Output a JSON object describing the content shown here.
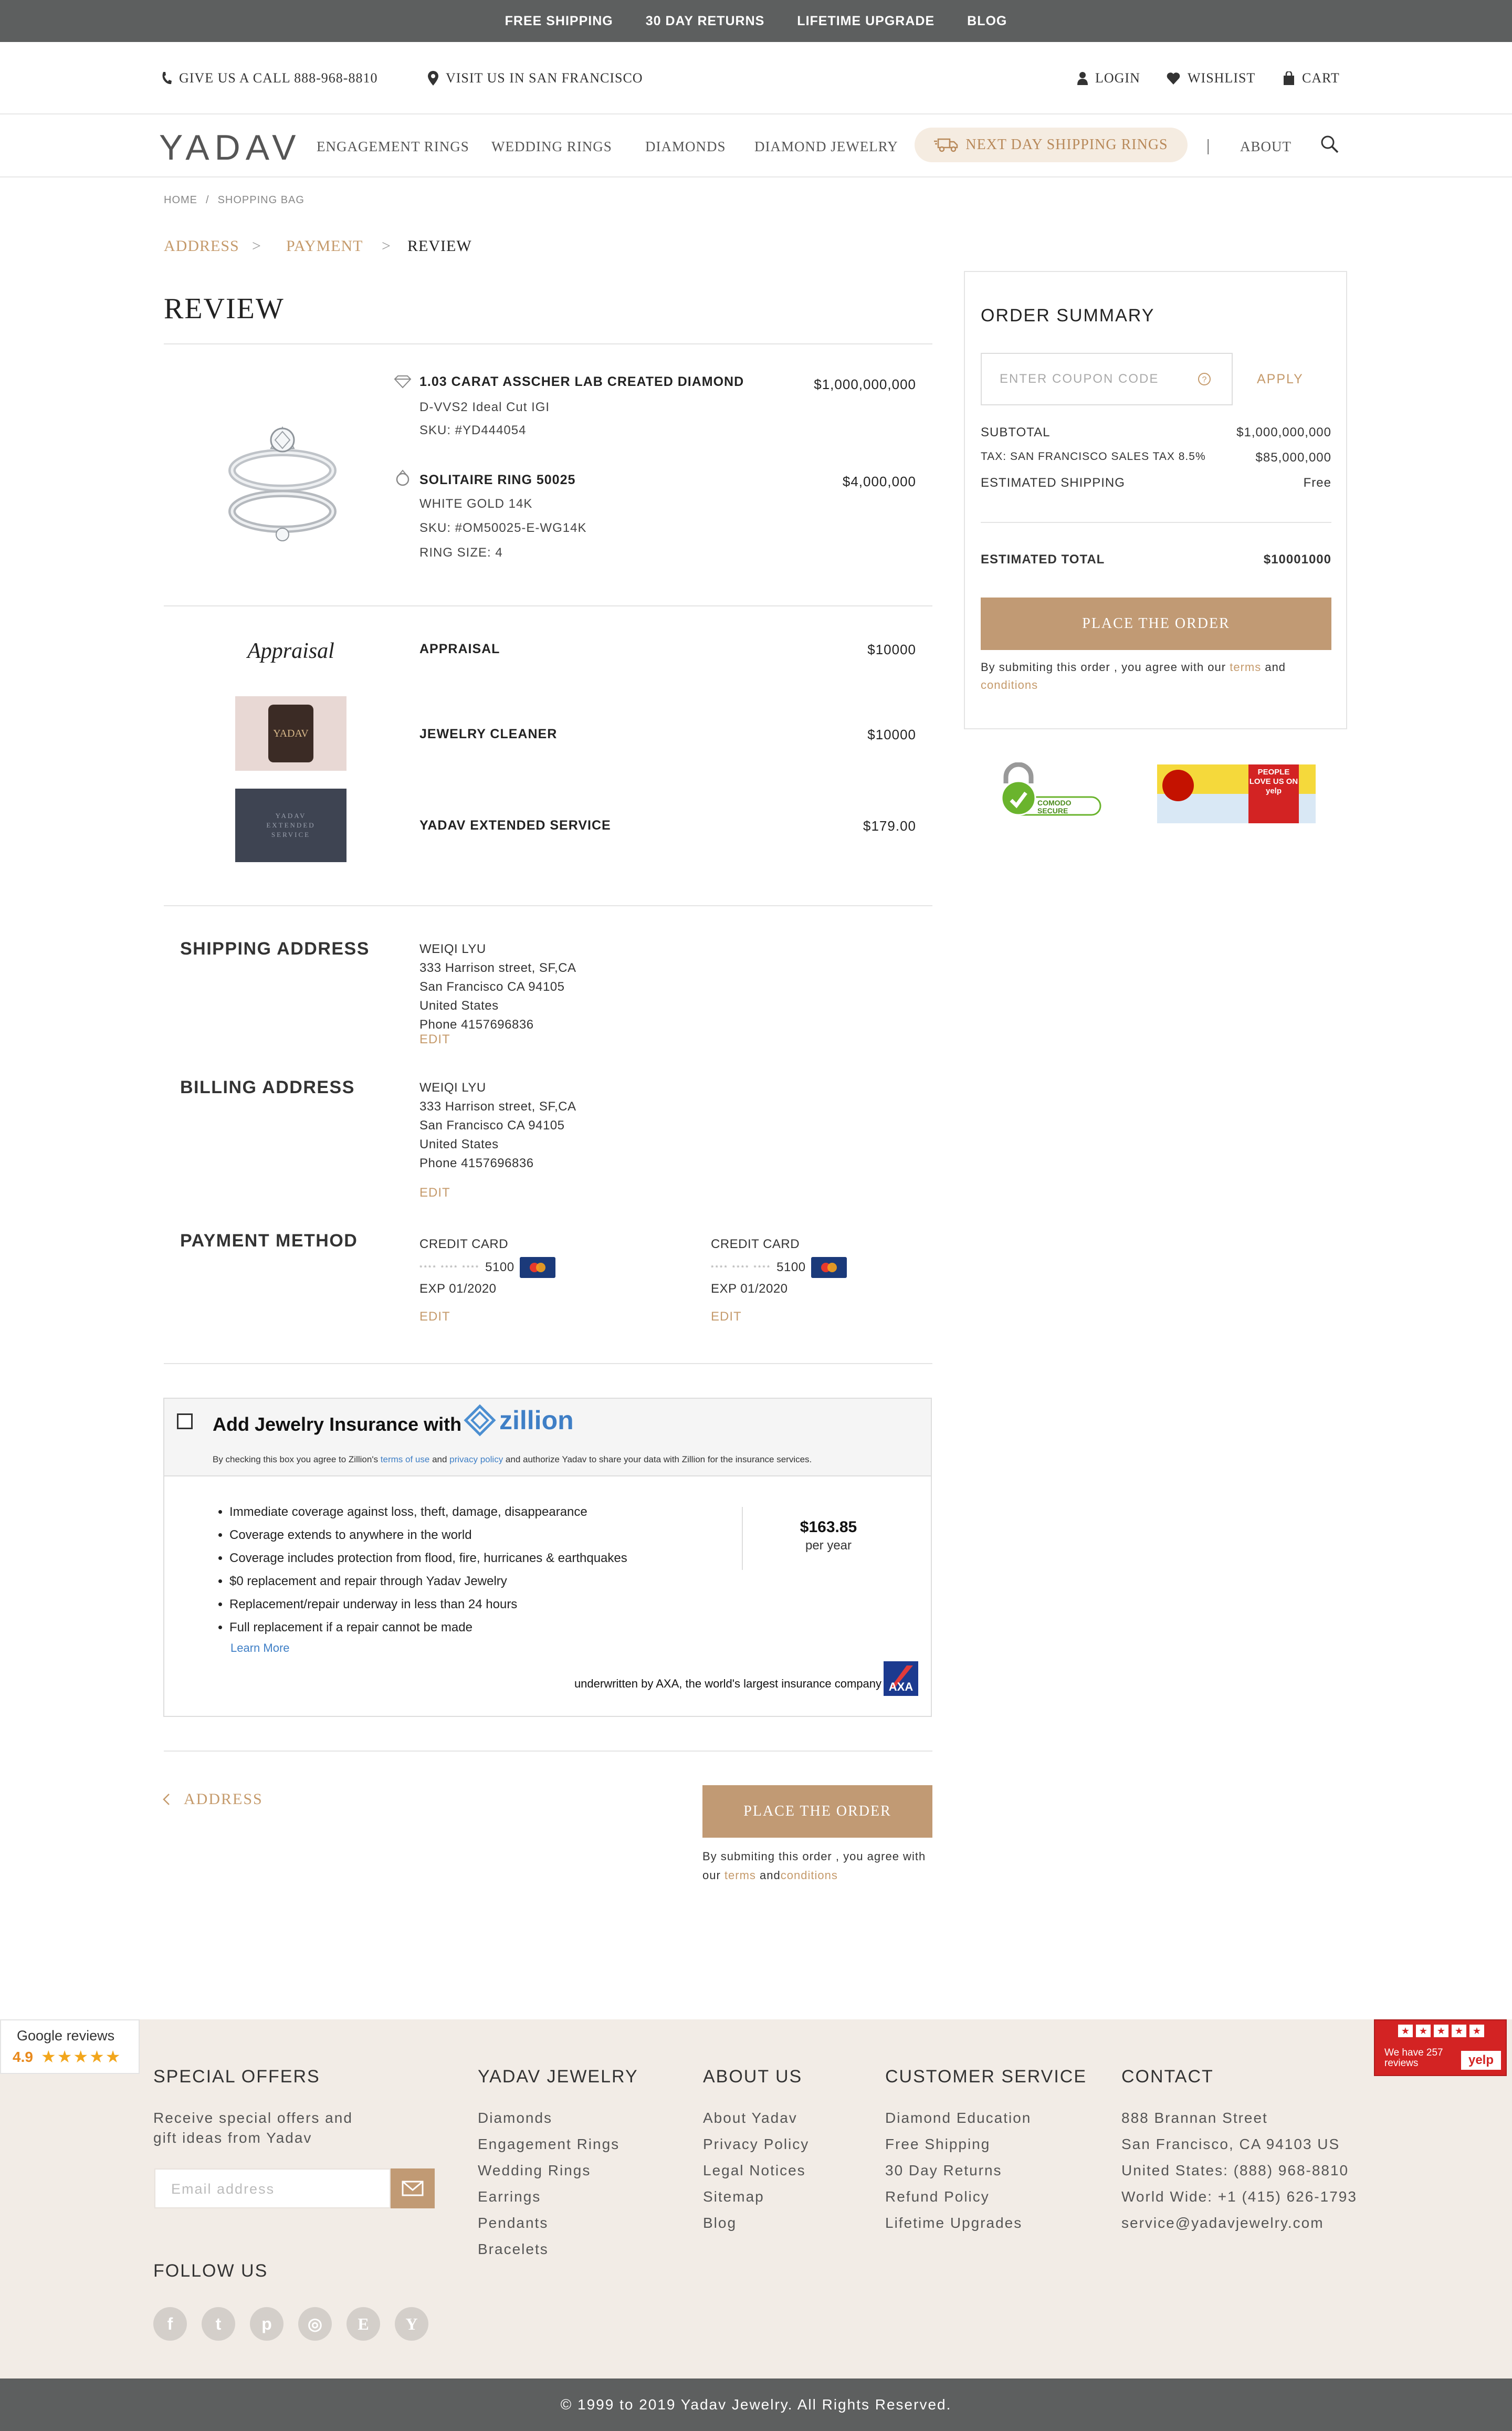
{
  "promo": [
    "FREE SHIPPING",
    "30 DAY RETURNS",
    "LIFETIME UPGRADE",
    "BLOG"
  ],
  "utility": {
    "call": "GIVE US A CALL 888-968-8810",
    "visit": "VISIT US IN SAN FRANCISCO",
    "login": "LOGIN",
    "wishlist": "WISHLIST",
    "cart": "CART"
  },
  "nav": {
    "logo": "YADAV",
    "items": [
      "ENGAGEMENT RINGS",
      "WEDDING RINGS",
      "DIAMONDS",
      "DIAMOND JEWELRY"
    ],
    "pill": "NEXT DAY SHIPPING RINGS",
    "separator": "|",
    "about": "ABOUT"
  },
  "breadcrumb": [
    "HOME",
    "/",
    "SHOPPING BAG"
  ],
  "steps": [
    "ADDRESS",
    ">",
    "PAYMENT",
    ">",
    "REVIEW"
  ],
  "page_title": "REVIEW",
  "items": [
    {
      "title": "1.03 CARAT ASSCHER LAB CREATED DIAMOND",
      "lines": [
        "D-VVS2 Ideal Cut IGI",
        "SKU: #YD444054"
      ],
      "price": "$1,000,000,000"
    },
    {
      "title": "SOLITAIRE RING 50025",
      "lines": [
        "WHITE GOLD 14K",
        "SKU: #OM50025-E-WG14K",
        "RING SIZE: 4"
      ],
      "price": "$4,000,000"
    }
  ],
  "addons": [
    {
      "thumb": "Appraisal",
      "title": "APPRAISAL",
      "price": "$10000"
    },
    {
      "thumb": "YADAV",
      "title": "JEWELRY CLEANER",
      "price": "$10000"
    },
    {
      "thumb": "YADAV EXTENDED SERVICE",
      "title": "YADAV EXTENDED SERVICE",
      "price": "$179.00"
    }
  ],
  "shipping": {
    "title": "SHIPPING ADDRESS",
    "lines": [
      "WEIQI LYU",
      "333 Harrison street, SF,CA",
      "San Francisco CA 94105",
      "United States",
      "Phone 4157696836"
    ],
    "edit": "EDIT"
  },
  "billing": {
    "title": "BILLING ADDRESS",
    "lines": [
      "WEIQI LYU",
      "333 Harrison street, SF,CA",
      "San Francisco CA 94105",
      "United States",
      "Phone 4157696836"
    ],
    "edit": "EDIT"
  },
  "payment": {
    "title": "PAYMENT METHOD",
    "cards": [
      {
        "label": "CREDIT CARD",
        "masked": "**** **** ****",
        "last4": "5100",
        "exp": "EXP 01/2020",
        "edit": "EDIT"
      },
      {
        "label": "CREDIT CARD",
        "masked": "**** **** ****",
        "last4": "5100",
        "exp": "EXP 01/2020",
        "edit": "EDIT"
      }
    ]
  },
  "insurance": {
    "title": "Add Jewelry Insurance with",
    "brand": "zillion",
    "consent_pre": "By checking this box you agree to Zillion's ",
    "terms_of_use": "terms of use",
    "and": " and ",
    "privacy": "privacy policy",
    "consent_post": " and authorize Yadav to share your data with Zillion for the insurance services.",
    "bullets": [
      "Immediate coverage against loss, theft, damage, disappearance",
      "Coverage extends to anywhere in the world",
      "Coverage includes protection from flood, fire, hurricanes & earthquakes",
      "$0 replacement and repair through Yadav Jewelry",
      "Replacement/repair underway in less than 24 hours",
      "Full replacement if a repair cannot be made"
    ],
    "learn_more": "Learn More",
    "price": "$163.85",
    "per": "per year",
    "underwritten": "underwritten by AXA, the world's largest insurance company",
    "axa": "AXA"
  },
  "back_link": "ADDRESS",
  "place_order": "PLACE THE ORDER",
  "bottom_terms": {
    "pre": "By submiting this order , you agree with our ",
    "terms": "terms",
    "and": " and",
    "conditions": "conditions"
  },
  "summary": {
    "title": "ORDER SUMMARY",
    "coupon_placeholder": "ENTER COUPON CODE",
    "apply": "APPLY",
    "rows": [
      {
        "label": "SUBTOTAL",
        "value": "$1,000,000,000"
      },
      {
        "label": "TAX: SAN FRANCISCO SALES TAX 8.5%",
        "value": "$85,000,000"
      },
      {
        "label": "ESTIMATED SHIPPING",
        "value": "Free"
      }
    ],
    "total_label": "ESTIMATED TOTAL",
    "total_value": "$10001000",
    "button": "PLACE THE ORDER",
    "terms_pre": "By submiting this order , you agree with our ",
    "terms": "terms",
    "and": " and ",
    "conditions": "conditions"
  },
  "badges": {
    "comodo": "COMODO SECURE",
    "yelp": "PEOPLE LOVE US ON yelp"
  },
  "google_reviews": {
    "label": "Google reviews",
    "rating": "4.9",
    "stars": "★★★★★"
  },
  "yelp_reviews": {
    "text": "We have 257 reviews",
    "yelp": "yelp"
  },
  "footer": {
    "special": {
      "title": "SPECIAL OFFERS",
      "text": [
        "Receive special offers and",
        "gift ideas from Yadav"
      ],
      "placeholder": "Email address"
    },
    "follow": "FOLLOW US",
    "social": [
      "f",
      "t",
      "p",
      "◎",
      "E",
      "Y"
    ],
    "columns": [
      {
        "title": "YADAV JEWELRY",
        "links": [
          "Diamonds",
          "Engagement Rings",
          "Wedding Rings",
          "Earrings",
          "Pendants",
          "Bracelets"
        ]
      },
      {
        "title": "ABOUT US",
        "links": [
          "About Yadav",
          "Privacy Policy",
          "Legal Notices",
          "Sitemap",
          "Blog"
        ]
      },
      {
        "title": "CUSTOMER SERVICE",
        "links": [
          "Diamond Education",
          "Free Shipping",
          "30 Day Returns",
          "Refund Policy",
          "Lifetime Upgrades"
        ]
      },
      {
        "title": "CONTACT",
        "links": [
          "888 Brannan Street",
          "San Francisco, CA 94103 US",
          "United States: (888) 968-8810",
          "World Wide: +1 (415) 626-1793",
          "service@yadavjewelry.com"
        ]
      }
    ],
    "copyright": "© 1999 to 2019 Yadav Jewelry. All Rights Reserved."
  },
  "colors": {
    "gold": "#c59a6b",
    "button": "#c19a74",
    "bar": "#5d5f5f",
    "footer": "#f2ece6"
  }
}
